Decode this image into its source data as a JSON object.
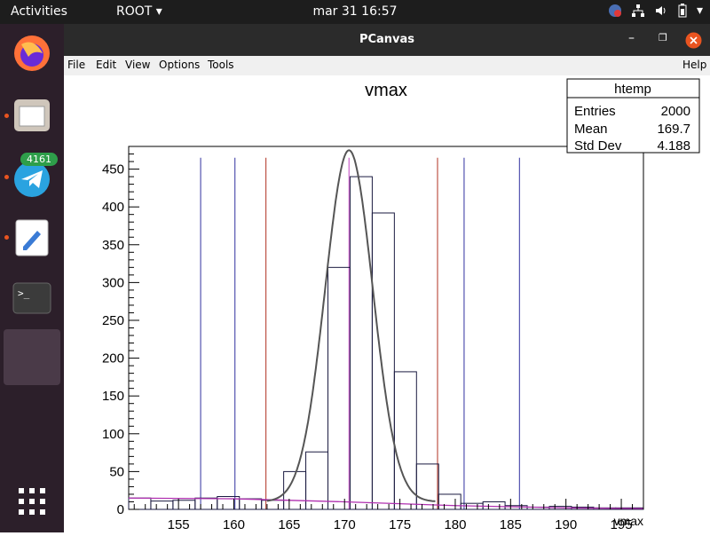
{
  "topbar": {
    "activities": "Activities",
    "app_menu": "ROOT",
    "clock": "mar 31  16:57"
  },
  "dock": {
    "telegram_badge": "4161",
    "items": [
      "firefox",
      "files",
      "telegram",
      "text-editor",
      "terminal",
      "root-window",
      "show-apps"
    ]
  },
  "window": {
    "title": "PCanvas",
    "menu": [
      "File",
      "Edit",
      "View",
      "Options",
      "Tools"
    ],
    "help": "Help"
  },
  "stats": {
    "name": "htemp",
    "rows": [
      {
        "label": "Entries",
        "value": "2000"
      },
      {
        "label": "Mean",
        "value": "169.7"
      },
      {
        "label": "Std Dev",
        "value": "4.188"
      }
    ]
  },
  "chart_data": {
    "type": "bar",
    "title": "vmax",
    "xlabel": "vmax",
    "ylabel": "",
    "xlim": [
      150.5,
      197
    ],
    "ylim": [
      0,
      480
    ],
    "xticks": [
      155,
      160,
      165,
      170,
      175,
      180,
      185,
      190,
      195
    ],
    "yticks": [
      0,
      50,
      100,
      150,
      200,
      250,
      300,
      350,
      400,
      450
    ],
    "bin_edges": [
      150.5,
      152.5,
      154.5,
      156.5,
      158.5,
      160.5,
      162.5,
      164.5,
      166.5,
      168.5,
      170.5,
      172.5,
      174.5,
      176.5,
      178.5,
      180.5,
      182.5,
      184.5,
      186.5,
      188.5,
      190.5,
      192.5,
      194.5,
      197
    ],
    "bin_values": [
      15,
      11,
      12,
      15,
      17,
      14,
      12,
      50,
      76,
      320,
      440,
      392,
      182,
      60,
      20,
      8,
      10,
      5,
      3,
      4,
      3,
      2,
      2
    ],
    "fit_gaussian": {
      "mean": 170.4,
      "sigma": 2.15,
      "amplitude": 465
    },
    "background_line": {
      "x": [
        150.5,
        160,
        170,
        180,
        190,
        197
      ],
      "y": [
        15,
        14,
        10,
        5,
        2,
        1
      ]
    },
    "vertical_lines": [
      {
        "x": 157.0,
        "color": "#3030a0"
      },
      {
        "x": 160.1,
        "color": "#3030a0"
      },
      {
        "x": 162.9,
        "color": "#b03020"
      },
      {
        "x": 170.4,
        "color": "#c040c0"
      },
      {
        "x": 178.4,
        "color": "#b03020"
      },
      {
        "x": 180.8,
        "color": "#3030a0"
      },
      {
        "x": 185.8,
        "color": "#3030a0"
      }
    ],
    "colors": {
      "hist": "#1a1a40",
      "fit": "#555555",
      "background": "#b030b0"
    }
  }
}
